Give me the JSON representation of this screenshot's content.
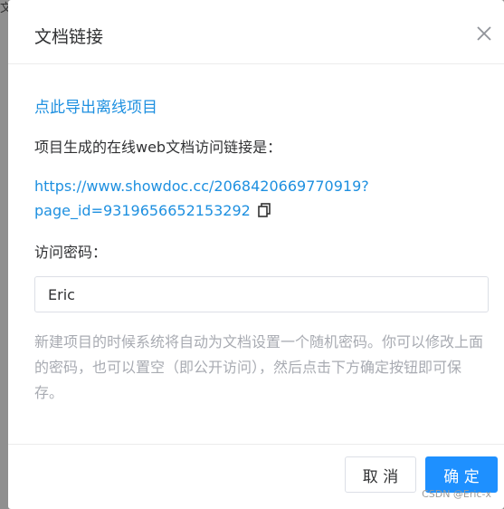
{
  "backdrop": {
    "text": "文"
  },
  "dialog": {
    "title": "文档链接",
    "close_icon": "close-icon",
    "export_link": "点此导出离线项目",
    "url_label": "项目生成的在线web文档访问链接是：",
    "url_line1": "https://www.showdoc.cc/2068420669770919?",
    "url_line2": "page_id=9319656652153292",
    "copy_icon": "copy-icon",
    "password_label": "访问密码：",
    "password_value": "Eric",
    "hint": "新建项目的时候系统将自动为文档设置一个随机密码。你可以修改上面的密码，也可以置空（即公开访问），然后点击下方确定按钮即可保存。",
    "cancel_label": "取 消",
    "confirm_label": "确 定"
  },
  "watermark": "CSDN @Eric-x",
  "colors": {
    "link": "#1e90e0",
    "primary": "#1e90ff",
    "hint": "#a8abb2",
    "text": "#303133"
  }
}
